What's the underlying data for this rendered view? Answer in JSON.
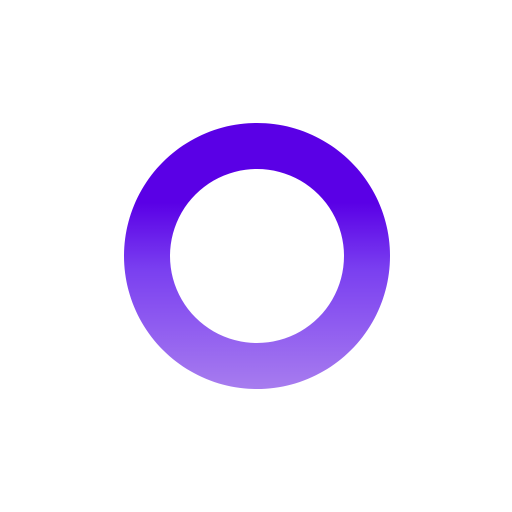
{
  "icon": {
    "name": "ring-icon",
    "colors": {
      "top": "#5a00e6",
      "middle": "#7a3ff0",
      "bottom": "#a77cef",
      "background": "#ffffff"
    }
  }
}
